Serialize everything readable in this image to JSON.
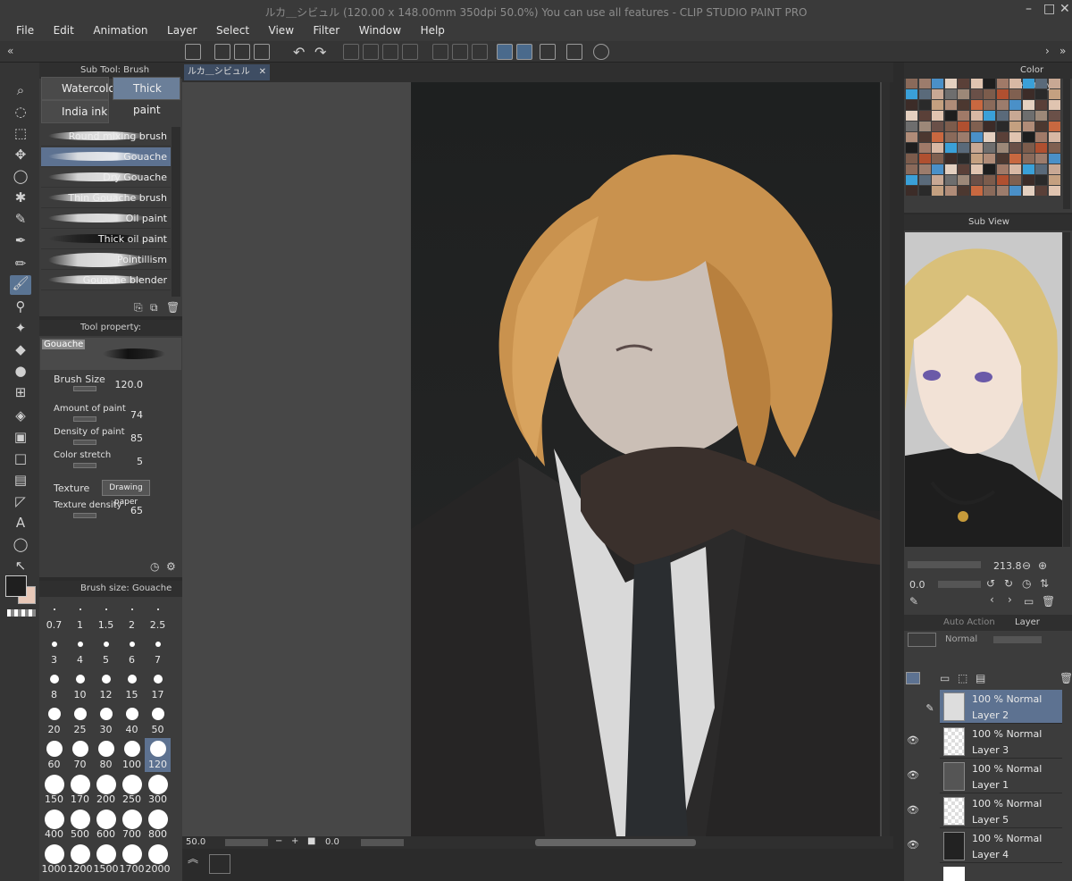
{
  "window": {
    "title": "ルカ＿シビュル (120.00 x 148.00mm 350dpi 50.0%)  You can use all features - CLIP STUDIO PAINT PRO",
    "controls": [
      "–",
      "□",
      "✕"
    ]
  },
  "menu": [
    "File",
    "Edit",
    "Animation",
    "Layer",
    "Select",
    "View",
    "Filter",
    "Window",
    "Help"
  ],
  "canvas_tab": "ルカ＿シビュル",
  "subtool_panel": {
    "title": "Sub Tool: Brush",
    "groups": [
      "Watercolor",
      "Thick paint",
      "India ink"
    ],
    "brushes": [
      "Round mixing brush",
      "Gouache",
      "Dry Gouache",
      "Thin Gouache brush",
      "Oil paint",
      "Thick oil paint",
      "Pointillism",
      "Gouache blender"
    ],
    "selected_brush": "Gouache"
  },
  "tool_property": {
    "title": "Tool property: Gouache",
    "preview_label": "Gouache",
    "brush_size_label": "Brush Size",
    "brush_size": "120.0",
    "amount_label": "Amount of paint",
    "amount": "74",
    "density_label": "Density of paint",
    "density": "85",
    "stretch_label": "Color stretch",
    "stretch": "5",
    "texture_label": "Texture",
    "texture_value": "Drawing paper",
    "texture_density_label": "Texture density",
    "texture_density": "65"
  },
  "brush_size_panel": {
    "title": "Brush size: Gouache",
    "sizes": [
      "0.7",
      "1",
      "1.5",
      "2",
      "2.5",
      "3",
      "4",
      "5",
      "6",
      "7",
      "8",
      "10",
      "12",
      "15",
      "17",
      "20",
      "25",
      "30",
      "40",
      "50",
      "60",
      "70",
      "80",
      "100",
      "120",
      "150",
      "170",
      "200",
      "250",
      "300",
      "400",
      "500",
      "600",
      "700",
      "800",
      "1000",
      "1200",
      "1500",
      "1700",
      "2000"
    ],
    "selected": "120"
  },
  "canvas_status": {
    "zoom": "50.0",
    "angle": "0.0"
  },
  "color_history": {
    "title": "Color History"
  },
  "sub_view": {
    "title": "Sub View",
    "zoom": "213.8",
    "angle": "0.0"
  },
  "layer_panel": {
    "tabs": [
      "Auto Action",
      "Layer"
    ],
    "blend_mode": "Normal",
    "layers": [
      {
        "opacity": "100 %",
        "mode": "Normal",
        "name": "Layer 2"
      },
      {
        "opacity": "100 %",
        "mode": "Normal",
        "name": "Layer 3"
      },
      {
        "opacity": "100 %",
        "mode": "Normal",
        "name": "Layer 1"
      },
      {
        "opacity": "100 %",
        "mode": "Normal",
        "name": "Layer 5"
      },
      {
        "opacity": "100 %",
        "mode": "Normal",
        "name": "Layer 4"
      }
    ]
  },
  "colors": {
    "main_color": "#1f1f1f",
    "sub_color": "#e8c8b8",
    "accent": "#5a7493",
    "canvas_bg": "#1e2020"
  }
}
